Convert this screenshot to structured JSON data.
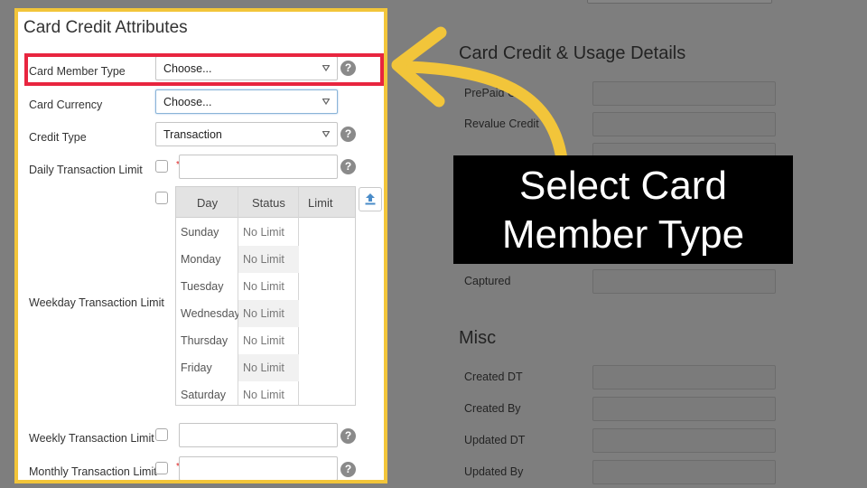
{
  "panel": {
    "title": "Card Credit Attributes",
    "fields": {
      "card_member_type": {
        "label": "Card Member Type",
        "value": "Choose..."
      },
      "card_currency": {
        "label": "Card Currency",
        "value": "Choose..."
      },
      "credit_type": {
        "label": "Credit Type",
        "value": "Transaction"
      },
      "daily_limit": {
        "label": "Daily Transaction Limit",
        "value": ""
      },
      "weekday_limit": {
        "label": "Weekday Transaction Limit"
      },
      "weekly_limit": {
        "label": "Weekly Transaction Limit",
        "value": ""
      },
      "monthly_limit": {
        "label": "Monthly Transaction Limit",
        "value": ""
      }
    },
    "required_mark": "*",
    "help_glyph": "?",
    "weekday_table": {
      "headers": [
        "Day",
        "Status",
        "Limit"
      ],
      "rows": [
        {
          "day": "Sunday",
          "status": "No Limit",
          "limit": ""
        },
        {
          "day": "Monday",
          "status": "No Limit",
          "limit": ""
        },
        {
          "day": "Tuesday",
          "status": "No Limit",
          "limit": ""
        },
        {
          "day": "Wednesday",
          "status": "No Limit",
          "limit": ""
        },
        {
          "day": "Thursday",
          "status": "No Limit",
          "limit": ""
        },
        {
          "day": "Friday",
          "status": "No Limit",
          "limit": ""
        },
        {
          "day": "Saturday",
          "status": "No Limit",
          "limit": ""
        }
      ]
    }
  },
  "background": {
    "usage_title": "Card Credit & Usage Details",
    "usage_rows": [
      "PrePaid Cr",
      "Revalue Credit",
      "",
      "",
      "",
      "",
      "Captured"
    ],
    "misc_title": "Misc",
    "misc_rows": [
      "Created DT",
      "Created By",
      "Updated DT",
      "Updated By"
    ]
  },
  "callout": {
    "line1": "Select Card",
    "line2": "Member Type"
  },
  "colors": {
    "highlight_border": "#e8253f",
    "panel_border": "#f2c53a",
    "arrow": "#f2c53a",
    "callout_bg": "#000000"
  }
}
